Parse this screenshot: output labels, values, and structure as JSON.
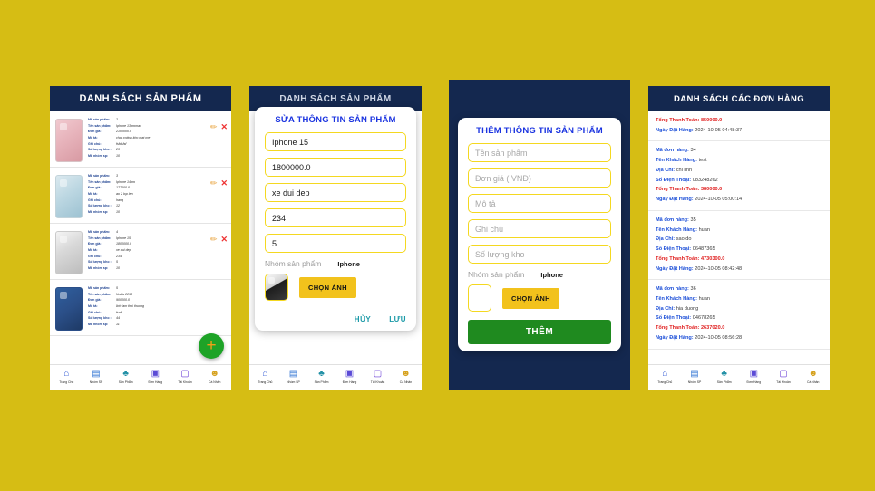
{
  "theme": {
    "background": "#d6bd14",
    "header_navy": "#14284f",
    "accent_yellow": "#f4d820",
    "title_blue": "#1b34e0",
    "money_red": "#e02020",
    "green": "#1f8a1f"
  },
  "products_screen": {
    "header": "DANH SÁCH  SẢN PHẨM",
    "field_labels": {
      "id": "Mã sản phẩm:",
      "name": "Tên sản phẩm:",
      "price": "Đơn giá :",
      "desc": "Mô tả:",
      "note": "Ghi chú:",
      "stock": "Số lượng kho :",
      "group": "Mã nhóm sp:"
    },
    "items": [
      {
        "id": "2",
        "name": "Iphone 13promax",
        "price": "2100000.0",
        "desc": "chat cotton kho mat me",
        "note": "fsfdsfsf",
        "stock": "23",
        "group": "10",
        "edit_icon": "pencil-icon",
        "delete_icon": "close-icon"
      },
      {
        "id": "3",
        "name": "Iphone 14pro",
        "price": "177000.0",
        "desc": "ao 2 lop len",
        "note": "hang",
        "stock": "12",
        "group": "10",
        "edit_icon": "pencil-icon",
        "delete_icon": "close-icon"
      },
      {
        "id": "4",
        "name": "Iphone 15",
        "price": "1800000.0",
        "desc": "xe dui dep",
        "note": "234",
        "stock": "5",
        "group": "10",
        "edit_icon": "pencil-icon",
        "delete_icon": "close-icon"
      },
      {
        "id": "5",
        "name": "Nokia 2293",
        "price": "900000.0",
        "desc": "lich lam thoi thuong",
        "note": "fsaf",
        "stock": "44",
        "group": "11",
        "edit_icon": "pencil-icon",
        "delete_icon": "close-icon"
      }
    ],
    "add_button": "+"
  },
  "edit_screen": {
    "header": "DANH SÁCH  SẢN PHẨM",
    "dialog": {
      "title": "SỬA THÔNG TIN SẢN PHẨM",
      "fields": [
        {
          "name": "Iphone 15"
        },
        {
          "name": "1800000.0"
        },
        {
          "name": "xe dui dep"
        },
        {
          "name": "234"
        },
        {
          "name": "5"
        }
      ],
      "group_label": "Nhóm sản phẩm",
      "group_value": "Iphone",
      "pick_image": "CHỌN ẢNH",
      "cancel": "HỦY",
      "save": "LƯU"
    }
  },
  "add_screen": {
    "dialog": {
      "title": "THÊM THÔNG TIN SẢN PHẨM",
      "placeholders": [
        {
          "text": "Tên sản phẩm"
        },
        {
          "text": "Đơn giá ( VNĐ)"
        },
        {
          "text": "Mô tả"
        },
        {
          "text": "Ghi chú"
        },
        {
          "text": "Số lượng kho"
        }
      ],
      "group_label": "Nhóm sản phẩm",
      "group_value": "Iphone",
      "pick_image": "CHỌN ẢNH",
      "submit": "THÊM"
    }
  },
  "orders_screen": {
    "header": "DANH SÁCH CÁC ĐƠN HÀNG",
    "field_labels": {
      "id": "Mã đơn hàng:",
      "customer": "Tên Khách Hàng:",
      "address": "Địa Chỉ:",
      "phone": "Số Điện Thoại:",
      "total": "Tổng Thanh Toán:",
      "date": "Ngày Đặt Hàng:"
    },
    "partial_top": {
      "total": "850000.0",
      "date": "2024-10-05 04:48:37"
    },
    "items": [
      {
        "id": "34",
        "customer": "test",
        "address": "chi linh",
        "phone": "083248262",
        "total": "380000.0",
        "date": "2024-10-05 05:00:14"
      },
      {
        "id": "35",
        "customer": "huan",
        "address": "sao do",
        "phone": "06487365",
        "total": "4730300.0",
        "date": "2024-10-05 08:42:48"
      },
      {
        "id": "36",
        "customer": "huan",
        "address": "hia duong",
        "phone": "04678265",
        "total": "2637020.0",
        "date": "2024-10-05 08:56:28"
      }
    ]
  },
  "bottom_nav": {
    "items": [
      {
        "label": "Trang Chủ",
        "icon": "home-icon",
        "glyph": "⌂"
      },
      {
        "label": "Nhóm SP",
        "icon": "folder-icon",
        "glyph": "▤"
      },
      {
        "label": "Sản Phẩm",
        "icon": "shirt-icon",
        "glyph": "♣"
      },
      {
        "label": "Đơn Hàng",
        "icon": "order-list-icon",
        "glyph": "▣"
      },
      {
        "label": "Tài Khoản",
        "icon": "account-card-icon",
        "glyph": "▢"
      },
      {
        "label": "Cá Nhân",
        "icon": "person-icon",
        "glyph": "☻"
      }
    ]
  }
}
